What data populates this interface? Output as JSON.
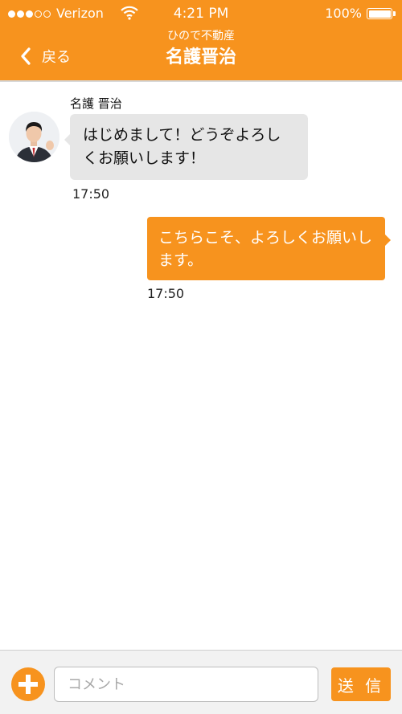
{
  "status_bar": {
    "carrier": "Verizon",
    "time": "4:21 PM",
    "battery_percent": "100%",
    "battery_level": 1.0,
    "signal_bars_filled": 3,
    "signal_bars_total": 5,
    "icons": [
      "signal-dots-icon",
      "wifi-icon",
      "battery-icon"
    ]
  },
  "header": {
    "back_label": "戻る",
    "back_icon": "chevron-left-icon",
    "subtitle": "ひので不動産",
    "title": "名護晋治"
  },
  "colors": {
    "accent": "#f7931e",
    "incoming_bubble": "#e6e6e6"
  },
  "messages": [
    {
      "direction": "incoming",
      "sender": "名護 晋治",
      "text": "はじめまして！どうぞよろしくお願いします！",
      "time": "17:50"
    },
    {
      "direction": "outgoing",
      "text": "こちらこそ、よろしくお願いします。",
      "time": "17:50"
    }
  ],
  "input_bar": {
    "add_icon": "plus-icon",
    "placeholder": "コメント",
    "value": "",
    "send_label": "送 信"
  }
}
